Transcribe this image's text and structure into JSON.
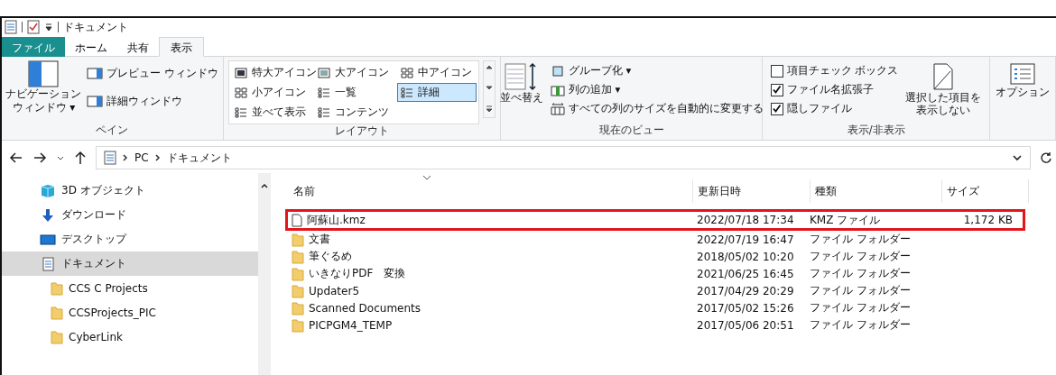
{
  "title_bar": {
    "title": "ドキュメント"
  },
  "tabs": [
    {
      "label": "ファイル",
      "kind": "file",
      "selected": false
    },
    {
      "label": "ホーム",
      "kind": "normal",
      "selected": false
    },
    {
      "label": "共有",
      "kind": "normal",
      "selected": false
    },
    {
      "label": "表示",
      "kind": "normal",
      "selected": true
    }
  ],
  "ribbon": {
    "pane": {
      "label": "ペイン",
      "nav_lines": [
        "ナビゲーション",
        "ウィンドウ ▾"
      ],
      "preview": "プレビュー ウィンドウ",
      "details": "詳細ウィンドウ"
    },
    "layout": {
      "label": "レイアウト",
      "items": [
        {
          "label": "特大アイコン",
          "kind": "xl",
          "selected": false
        },
        {
          "label": "大アイコン",
          "kind": "large",
          "selected": false
        },
        {
          "label": "中アイコン",
          "kind": "medium",
          "selected": false
        },
        {
          "label": "小アイコン",
          "kind": "small",
          "selected": false
        },
        {
          "label": "一覧",
          "kind": "list",
          "selected": false
        },
        {
          "label": "詳細",
          "kind": "details",
          "selected": true
        },
        {
          "label": "並べて表示",
          "kind": "tiles",
          "selected": false
        },
        {
          "label": "コンテンツ",
          "kind": "content",
          "selected": false
        }
      ]
    },
    "current_view": {
      "label": "現在のビュー",
      "sort": "並べ替え",
      "group": "グループ化 ▾",
      "add_column": "列の追加 ▾",
      "autosize": "すべての列のサイズを自動的に変更する"
    },
    "show_hide": {
      "label": "表示/非表示",
      "checkboxes": [
        {
          "label": "項目チェック ボックス",
          "checked": false
        },
        {
          "label": "ファイル名拡張子",
          "checked": true
        },
        {
          "label": "隠しファイル",
          "checked": true
        }
      ],
      "hide_lines": [
        "選択した項目を",
        "表示しない"
      ]
    },
    "options": {
      "label": "オプション"
    }
  },
  "address_bar": {
    "segments": [
      "PC",
      "ドキュメント"
    ]
  },
  "sidebar": {
    "items": [
      {
        "label": "3D オブジェクト",
        "kind": "cube",
        "selected": false
      },
      {
        "label": "ダウンロード",
        "kind": "download",
        "selected": false
      },
      {
        "label": "デスクトップ",
        "kind": "desktop",
        "selected": false
      },
      {
        "label": "ドキュメント",
        "kind": "documents",
        "selected": true,
        "children": [
          {
            "label": "CCS C Projects",
            "kind": "folder",
            "selected": false
          },
          {
            "label": "CCSProjects_PIC",
            "kind": "folder",
            "selected": false
          },
          {
            "label": "CyberLink",
            "kind": "folder",
            "selected": false
          }
        ]
      }
    ]
  },
  "table": {
    "columns": [
      "名前",
      "更新日時",
      "種類",
      "サイズ"
    ],
    "rows": [
      {
        "name": "阿蘇山.kmz",
        "kind": "file",
        "date": "2022/07/18 17:34",
        "type": "KMZ ファイル",
        "size": "1,172 KB",
        "highlighted": true
      },
      {
        "name": "文書",
        "kind": "folder",
        "date": "2022/07/19 16:47",
        "type": "ファイル フォルダー",
        "highlighted": false
      },
      {
        "name": "筆ぐるめ",
        "kind": "folder",
        "date": "2018/05/02 10:20",
        "type": "ファイル フォルダー",
        "highlighted": false
      },
      {
        "name": "いきなりPDF　変換",
        "kind": "folder",
        "date": "2021/06/25 16:45",
        "type": "ファイル フォルダー",
        "highlighted": false
      },
      {
        "name": "Updater5",
        "kind": "folder",
        "date": "2017/04/29 20:29",
        "type": "ファイル フォルダー",
        "highlighted": false
      },
      {
        "name": "Scanned Documents",
        "kind": "folder",
        "date": "2017/05/02 15:26",
        "type": "ファイル フォルダー",
        "highlighted": false
      },
      {
        "name": "PICPGM4_TEMP",
        "kind": "folder",
        "date": "2017/05/06 20:51",
        "type": "ファイル フォルダー",
        "highlighted": false
      }
    ]
  }
}
